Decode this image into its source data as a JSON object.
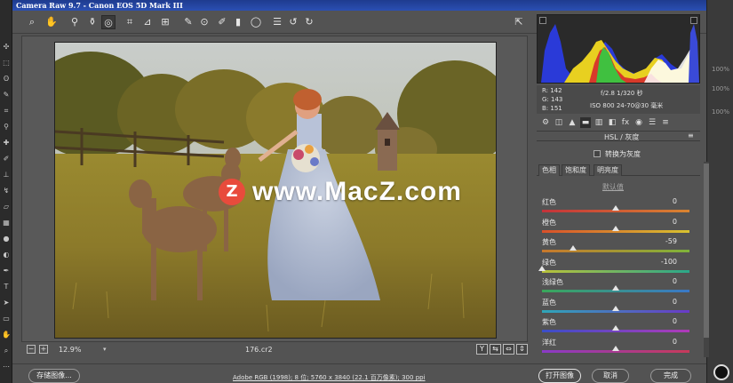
{
  "window": {
    "title": "Camera Raw 9.7 -  Canon EOS 5D Mark III"
  },
  "toolbar": {
    "tools": [
      {
        "name": "zoom-tool",
        "glyph": "⌕"
      },
      {
        "name": "hand-tool",
        "glyph": "✋"
      },
      {
        "name": "white-balance-tool",
        "glyph": "⚲"
      },
      {
        "name": "color-sampler-tool",
        "glyph": "⚱"
      },
      {
        "name": "targeted-adjustment-tool",
        "glyph": "◎"
      },
      {
        "name": "crop-tool",
        "glyph": "⌗"
      },
      {
        "name": "straighten-tool",
        "glyph": "⊿"
      },
      {
        "name": "transform-tool",
        "glyph": "⊞"
      },
      {
        "name": "spot-removal-tool",
        "glyph": "✎"
      },
      {
        "name": "red-eye-tool",
        "glyph": "⊙"
      },
      {
        "name": "adjustment-brush-tool",
        "glyph": "✐"
      },
      {
        "name": "graduated-filter-tool",
        "glyph": "▮"
      },
      {
        "name": "radial-filter-tool",
        "glyph": "◯"
      },
      {
        "name": "preferences",
        "glyph": "☰"
      },
      {
        "name": "rotate-left",
        "glyph": "↺"
      },
      {
        "name": "rotate-right",
        "glyph": "↻"
      }
    ],
    "fullscreen_glyph": "⇱"
  },
  "watermark": {
    "logo": "Z",
    "text": "www.MacZ.com"
  },
  "status": {
    "zoom_minus": "−",
    "zoom_plus": "+",
    "zoom": "12.9%",
    "zoom_arrow": "▾",
    "filename": "176.cr2",
    "view_buttons": [
      "Y",
      "⇆",
      "⇔",
      "⇕"
    ]
  },
  "info": {
    "r": "R:  142",
    "g": "G:  143",
    "b": "B:  151",
    "aperture_shutter": "f/2.8   1/320 秒",
    "iso_lens": "ISO 800   24-70@30 毫米"
  },
  "panel": {
    "tabs": [
      "⚙",
      "◫",
      "▲",
      "▬",
      "▥",
      "◧",
      "fx",
      "◉",
      "☰",
      "≡"
    ],
    "title": "HSL / 灰度",
    "menu_glyph": "≡",
    "grayscale_label": "转换为灰度",
    "subtabs": [
      "色相",
      "饱和度",
      "明亮度"
    ],
    "default_link": "默认值",
    "sliders": [
      {
        "label": "红色",
        "value": "0",
        "pos": 0.5,
        "colors": [
          "#c4323a",
          "#d98430"
        ]
      },
      {
        "label": "橙色",
        "value": "0",
        "pos": 0.5,
        "colors": [
          "#d9502a",
          "#d8c22f"
        ]
      },
      {
        "label": "黄色",
        "value": "-59",
        "pos": 0.21,
        "colors": [
          "#c8782c",
          "#7fb43a"
        ]
      },
      {
        "label": "绿色",
        "value": "-100",
        "pos": 0.0,
        "colors": [
          "#b9c23a",
          "#2aa88a"
        ]
      },
      {
        "label": "浅绿色",
        "value": "0",
        "pos": 0.5,
        "colors": [
          "#3aa85a",
          "#3a78c8"
        ]
      },
      {
        "label": "蓝色",
        "value": "0",
        "pos": 0.5,
        "colors": [
          "#2fa6b8",
          "#6a3ac8"
        ]
      },
      {
        "label": "紫色",
        "value": "0",
        "pos": 0.5,
        "colors": [
          "#3a4ec8",
          "#b03ab8"
        ]
      },
      {
        "label": "洋红",
        "value": "0",
        "pos": 0.5,
        "colors": [
          "#8a3ac8",
          "#c83a5a"
        ]
      }
    ]
  },
  "bottom": {
    "save_label": "存储图像...",
    "workflow_link": "Adobe RGB (1998); 8 位; 5760 x 3840 (22.1 百万像素); 300 ppi",
    "open_label": "打开图像",
    "cancel_label": "取消",
    "done_label": "完成"
  },
  "ps": {
    "right_values": [
      "100%",
      "100%",
      "100%"
    ]
  }
}
